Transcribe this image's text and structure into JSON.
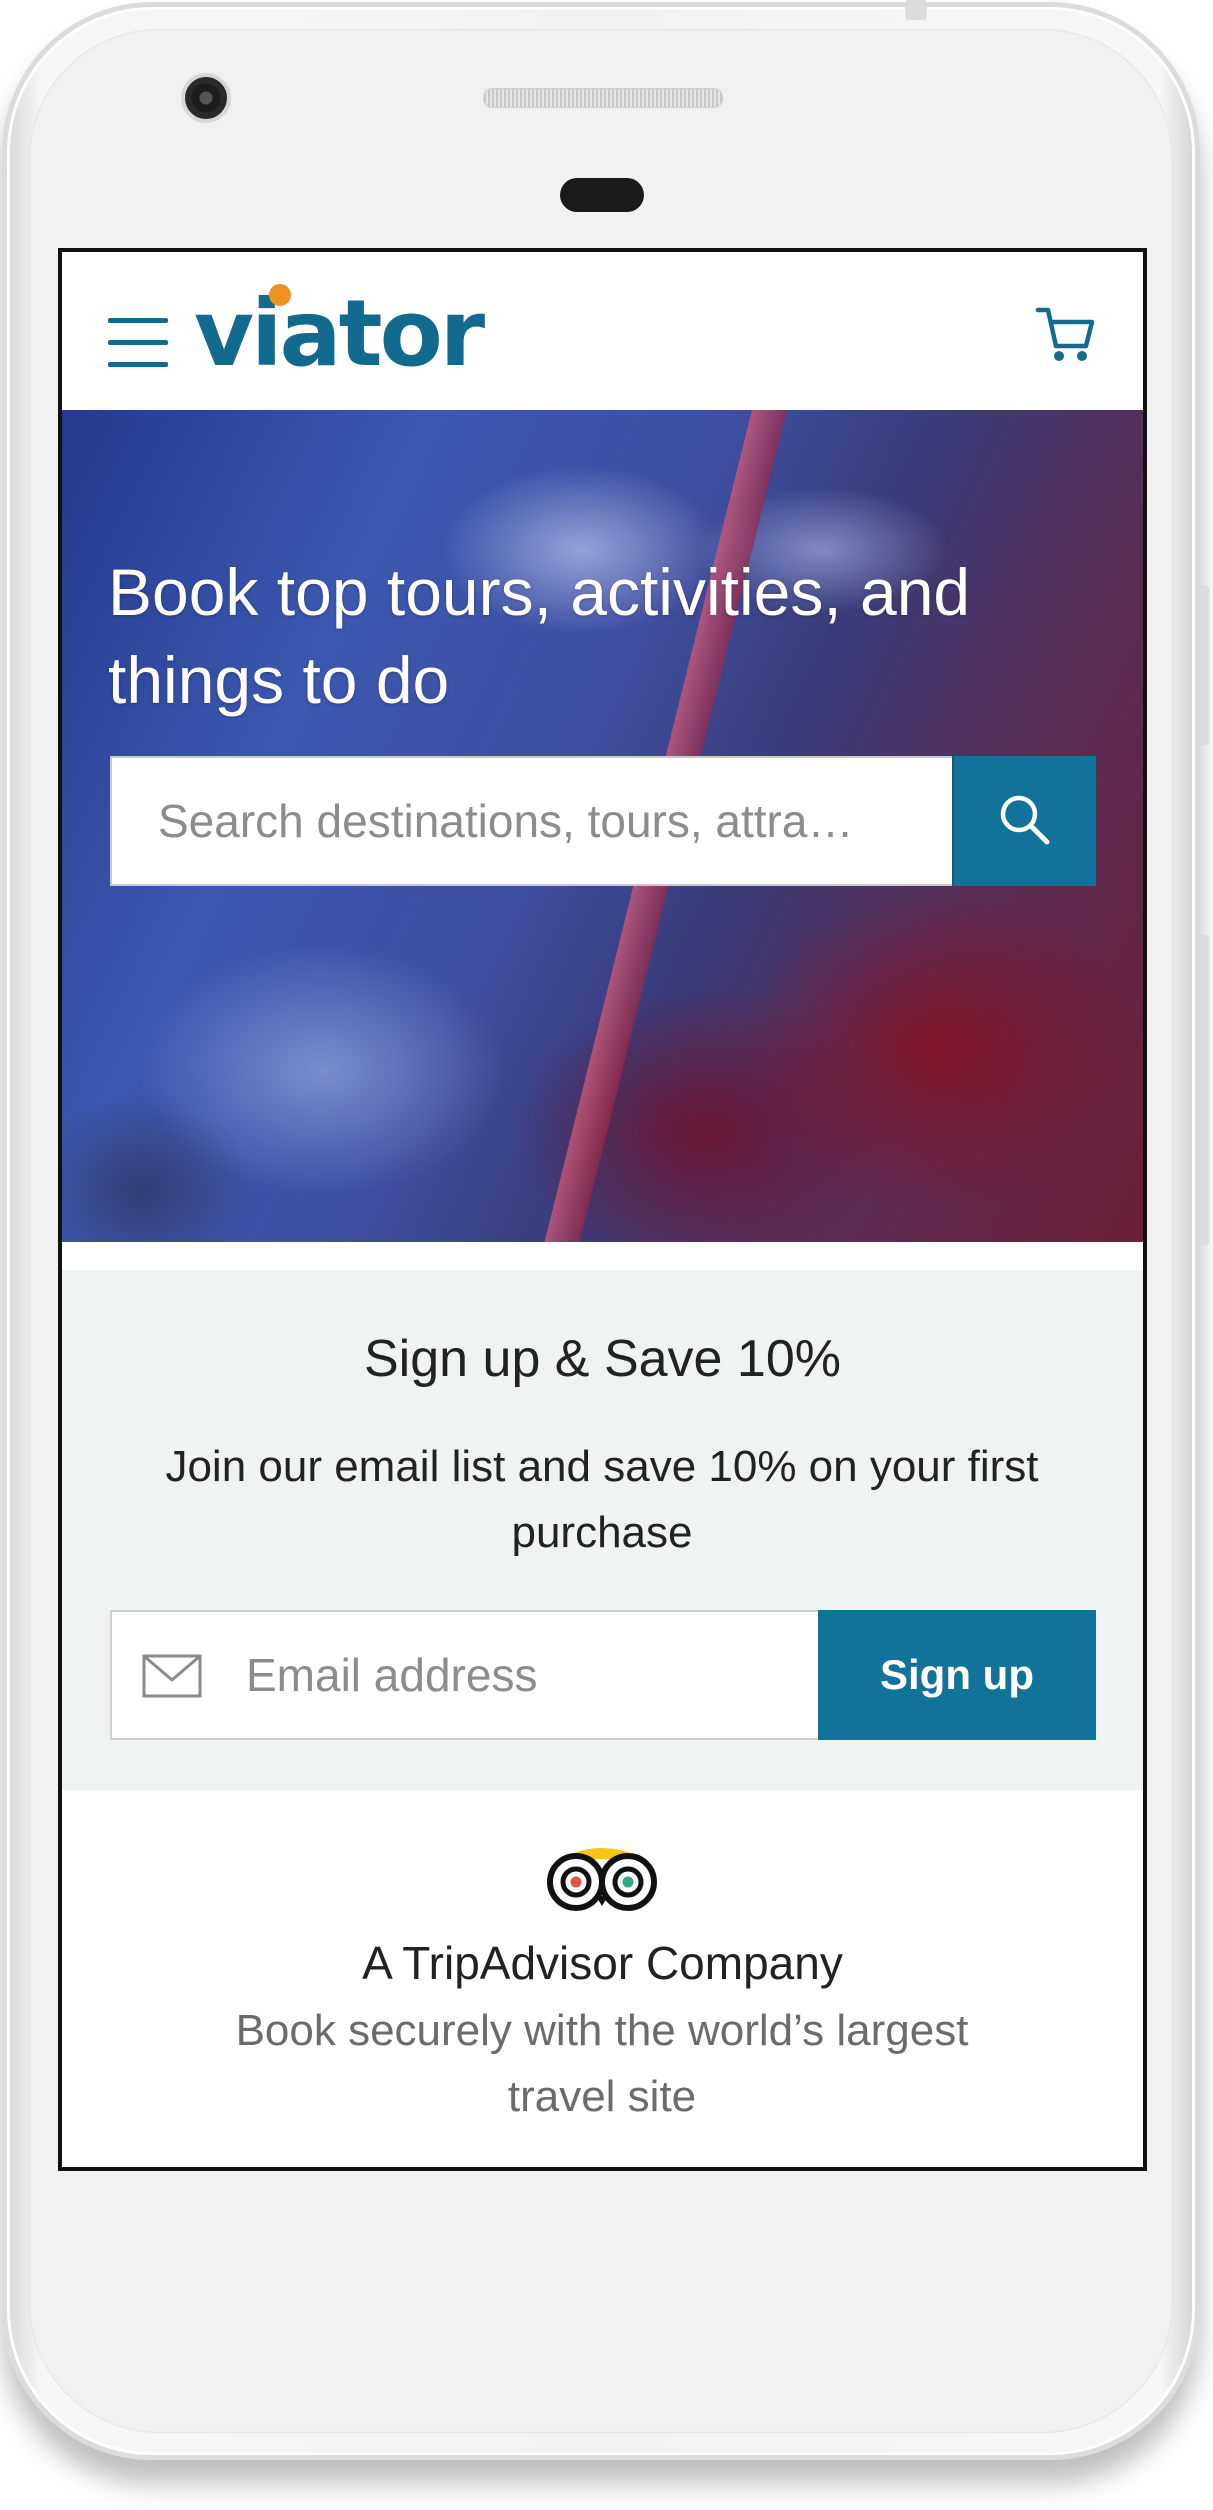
{
  "header": {
    "brand": "viator",
    "menu_icon": "hamburger-menu-icon",
    "cart_icon": "shopping-cart-icon"
  },
  "hero": {
    "title": "Book top tours, activities, and things to do",
    "search": {
      "placeholder": "Search destinations, tours, attra…",
      "value": "",
      "button_icon": "search-icon"
    }
  },
  "signup": {
    "title": "Sign up & Save 10%",
    "description": "Join our email list and save 10% on your first purchase",
    "email_placeholder": "Email address",
    "email_icon": "mail-icon",
    "button_label": "Sign up"
  },
  "footer": {
    "logo_icon": "tripadvisor-owl-icon",
    "company": "A TripAdvisor Company",
    "tagline": "Book securely with the world’s largest travel site"
  },
  "colors": {
    "brand_teal": "#12739a",
    "logo_blue": "#126a8e",
    "logo_accent": "#f09220",
    "signup_bg": "#f0f3f4",
    "text_dark": "#222222",
    "text_muted": "#6b6b6b"
  }
}
